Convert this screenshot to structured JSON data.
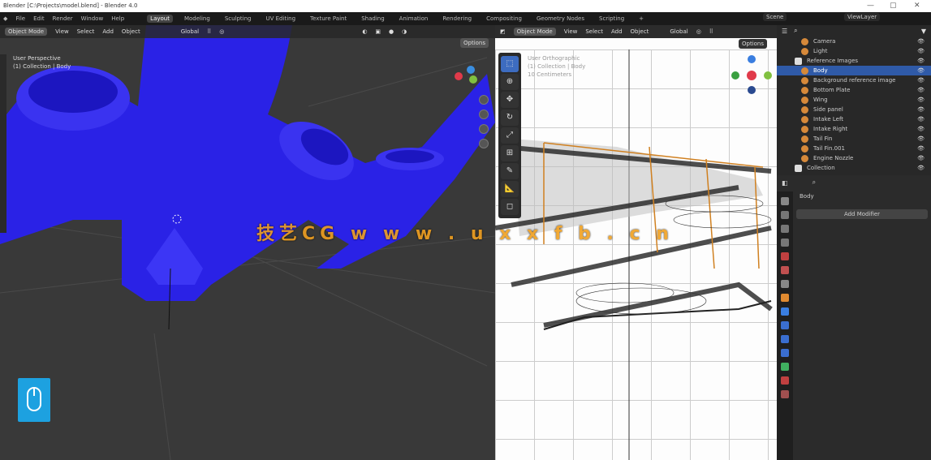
{
  "window": {
    "title": "Blender [C:\\Projects\\model.blend] - Blender 4.0",
    "minimize": "—",
    "maximize": "▢",
    "close": "✕"
  },
  "menu": [
    "File",
    "Edit",
    "Render",
    "Window",
    "Help"
  ],
  "workspaces": [
    "Layout",
    "Modeling",
    "Sculpting",
    "UV Editing",
    "Texture Paint",
    "Shading",
    "Animation",
    "Rendering",
    "Compositing",
    "Geometry Nodes",
    "Scripting",
    "+"
  ],
  "scene": "Scene",
  "view_layer": "ViewLayer",
  "viewport": {
    "mode": "Object Mode",
    "menus": [
      "View",
      "Select",
      "Add",
      "Object"
    ],
    "transform": "Global",
    "options": "Options",
    "overlay_line1": "User Perspective",
    "overlay_line2": "(1) Collection | Body"
  },
  "viewport2": {
    "mode": "Object Mode",
    "menus": [
      "View",
      "Select",
      "Add",
      "Object"
    ],
    "transform": "Global",
    "options": "Options",
    "overlay_line1": "User Orthographic",
    "overlay_line2": "(1) Collection | Body",
    "overlay_line3": "10 Centimeters"
  },
  "watermark": {
    "brand": "技艺CG",
    "url": "w w w .   u x x f b . c n"
  },
  "outliner": {
    "items": [
      {
        "label": "Camera",
        "collection": false,
        "selected": false
      },
      {
        "label": "Light",
        "collection": false,
        "selected": false
      },
      {
        "label": "Reference Images",
        "collection": true,
        "selected": false
      },
      {
        "label": "Body",
        "collection": false,
        "selected": true
      },
      {
        "label": "Background reference image",
        "collection": false,
        "selected": false
      },
      {
        "label": "Bottom Plate",
        "collection": false,
        "selected": false
      },
      {
        "label": "Wing",
        "collection": false,
        "selected": false
      },
      {
        "label": "Side panel",
        "collection": false,
        "selected": false
      },
      {
        "label": "Intake Left",
        "collection": false,
        "selected": false
      },
      {
        "label": "Intake Right",
        "collection": false,
        "selected": false
      },
      {
        "label": "Tail Fin",
        "collection": false,
        "selected": false
      },
      {
        "label": "Tail Fin.001",
        "collection": false,
        "selected": false
      },
      {
        "label": "Engine Nozzle",
        "collection": false,
        "selected": false
      },
      {
        "label": "Collection",
        "collection": true,
        "selected": false
      }
    ]
  },
  "properties": {
    "object": "Body",
    "add_button": "Add Modifier"
  },
  "colors": {
    "mesh": "#2020e0",
    "selection": "#2f5aa8",
    "accent": "#1da1e0"
  }
}
